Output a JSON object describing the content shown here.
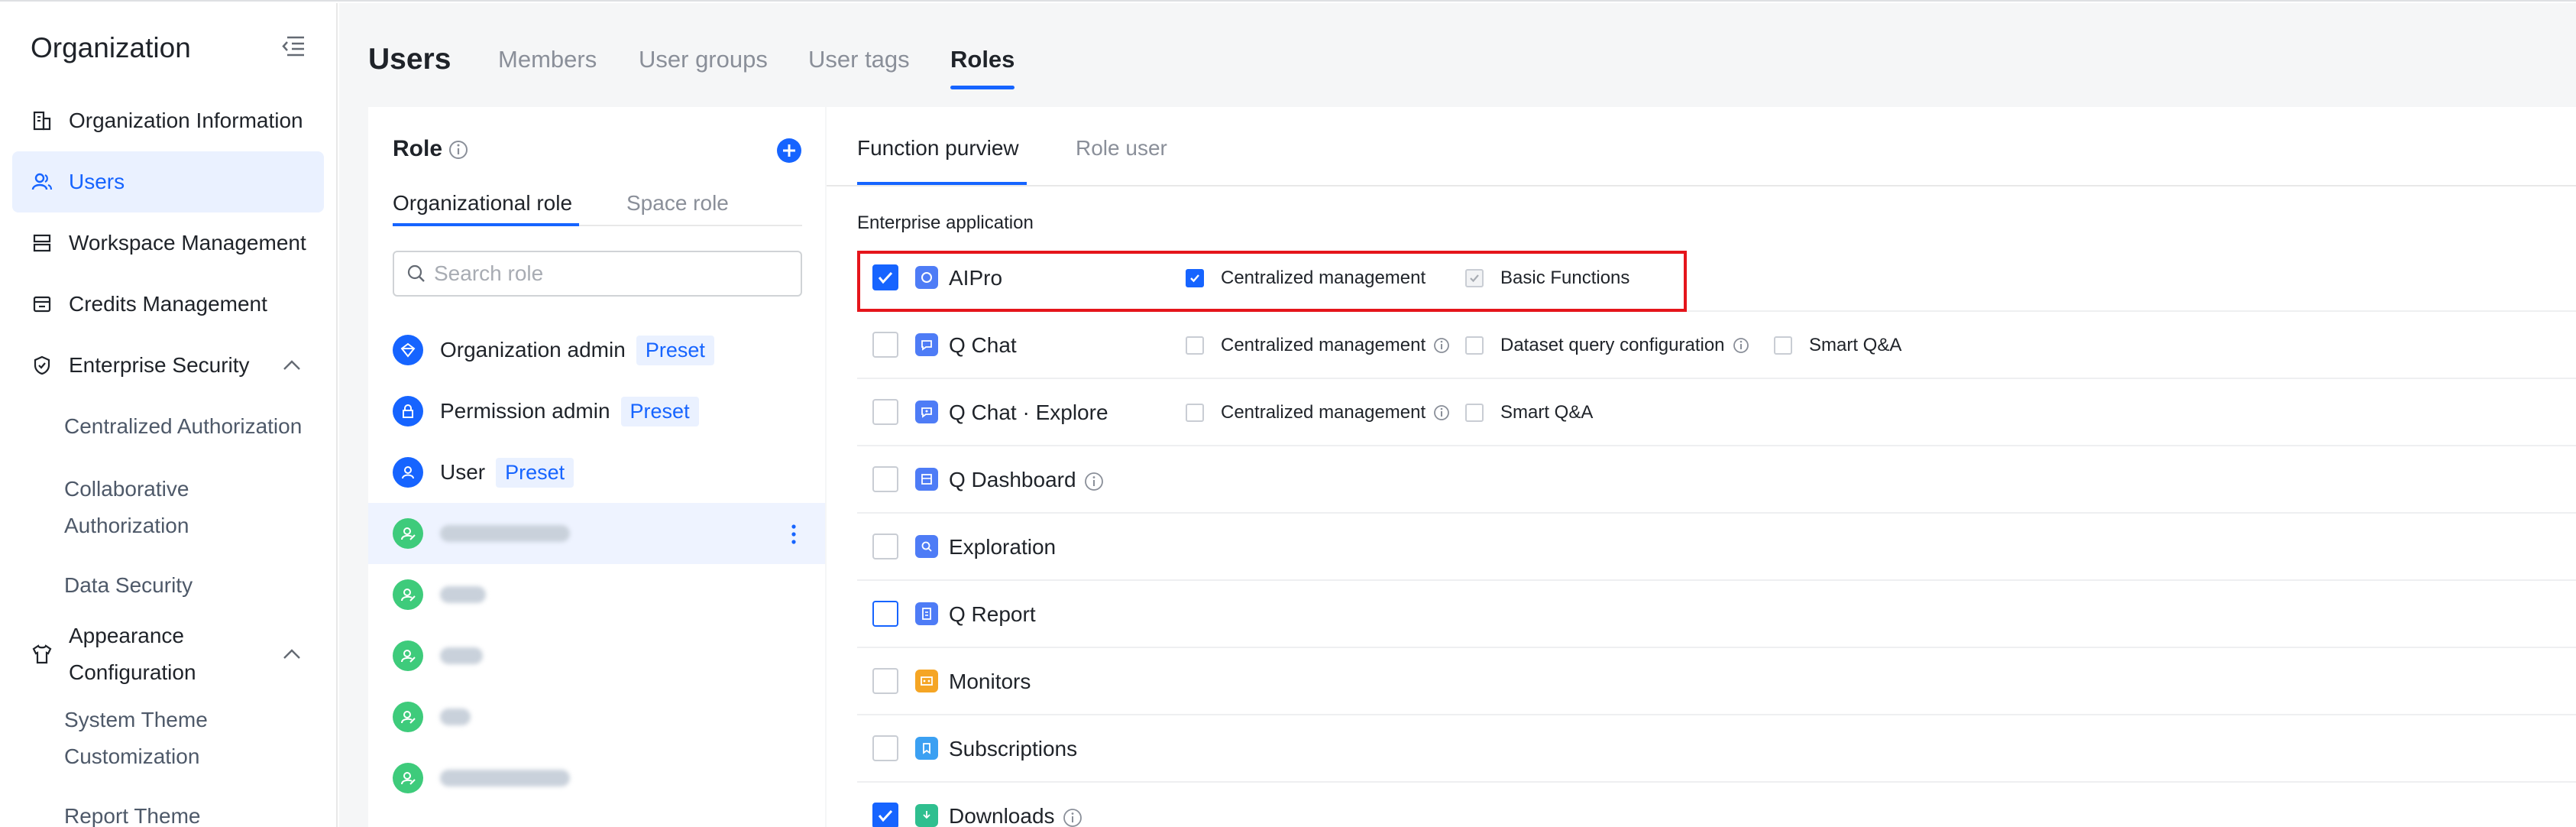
{
  "sidebar": {
    "title": "Organization",
    "items": [
      {
        "label": "Organization Information",
        "icon": "building-icon"
      },
      {
        "label": "Users",
        "icon": "users-icon",
        "active": true
      },
      {
        "label": "Workspace Management",
        "icon": "stack-icon"
      },
      {
        "label": "Credits Management",
        "icon": "wallet-icon"
      },
      {
        "label": "Enterprise Security",
        "icon": "shield-icon",
        "expanded": true
      }
    ],
    "security_sub": [
      "Centralized Authorization",
      "Collaborative Authorization",
      "Data Security"
    ],
    "appearance": {
      "label": "Appearance Configuration",
      "icon": "shirt-icon",
      "expanded": true
    },
    "appearance_sub": [
      "System Theme Customization",
      "Report Theme"
    ]
  },
  "header": {
    "title": "Users",
    "tabs": [
      "Members",
      "User groups",
      "User tags",
      "Roles"
    ],
    "active_tab": "Roles"
  },
  "role_panel": {
    "title": "Role",
    "tabs": [
      "Organizational role",
      "Space role"
    ],
    "search_placeholder": "Search role",
    "preset_label": "Preset",
    "roles": [
      {
        "name": "Organization admin",
        "preset": true,
        "icon": "shield-role-icon"
      },
      {
        "name": "Permission admin",
        "preset": true,
        "icon": "lock-role-icon"
      },
      {
        "name": "User",
        "preset": true,
        "icon": "user-role-icon"
      }
    ]
  },
  "function_panel": {
    "tabs": [
      "Function purview",
      "Role user"
    ],
    "section": "Enterprise application",
    "apps": [
      {
        "name": "AIPro",
        "checked": true,
        "icon_color": "#4e7cf6",
        "perms": [
          {
            "label": "Centralized management",
            "checked": true
          },
          {
            "label": "Basic Functions",
            "checked": true,
            "disabled": true
          }
        ]
      },
      {
        "name": "Q Chat",
        "checked": false,
        "icon_color": "#4e7cf6",
        "perms": [
          {
            "label": "Centralized management",
            "info": true
          },
          {
            "label": "Dataset query configuration",
            "info": true
          },
          {
            "label": "Smart Q&A"
          }
        ]
      },
      {
        "name": "Q Chat · Explore",
        "checked": false,
        "icon_color": "#4e7cf6",
        "perms": [
          {
            "label": "Centralized management",
            "info": true
          },
          {
            "label": "Smart Q&A"
          }
        ]
      },
      {
        "name": "Q Dashboard",
        "checked": false,
        "info": true,
        "icon_color": "#4e7cf6"
      },
      {
        "name": "Exploration",
        "checked": false,
        "icon_color": "#4e7cf6"
      },
      {
        "name": "Q Report",
        "checked": false,
        "highlight": true,
        "icon_color": "#4e7cf6"
      },
      {
        "name": "Monitors",
        "checked": false,
        "icon_color": "#f5a524"
      },
      {
        "name": "Subscriptions",
        "checked": false,
        "icon_color": "#3ba0f2"
      },
      {
        "name": "Downloads",
        "checked": true,
        "info": true,
        "icon_color": "#2fbf8f"
      }
    ]
  },
  "colors": {
    "accent": "#1664ff",
    "highlight_border": "#e5151b",
    "green_avatar": "#3ecb7b"
  }
}
